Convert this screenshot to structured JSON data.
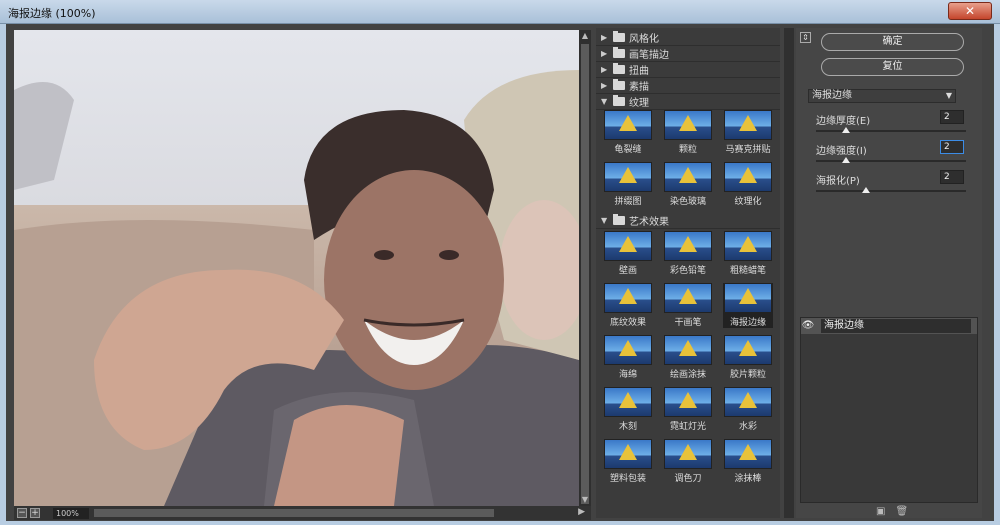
{
  "window": {
    "title": "海报边缘 (100%)",
    "close_label": "✕"
  },
  "preview": {
    "zoom": "100%",
    "zoom_out": "−",
    "zoom_in": "+"
  },
  "gallery": {
    "folders": [
      {
        "label": "风格化",
        "expanded": false
      },
      {
        "label": "画笔描边",
        "expanded": false
      },
      {
        "label": "扭曲",
        "expanded": false
      },
      {
        "label": "素描",
        "expanded": false
      },
      {
        "label": "纹理",
        "expanded": true
      },
      {
        "label": "艺术效果",
        "expanded": true
      }
    ],
    "texture_filters": [
      "龟裂缝",
      "颗粒",
      "马赛克拼贴",
      "拼缀图",
      "染色玻璃",
      "纹理化"
    ],
    "artistic_filters": [
      "壁画",
      "彩色铅笔",
      "粗糙蜡笔",
      "底纹效果",
      "干画笔",
      "海报边缘",
      "海绵",
      "绘画涂抹",
      "胶片颗粒",
      "木刻",
      "霓虹灯光",
      "水彩",
      "塑料包装",
      "调色刀",
      "涂抹棒"
    ],
    "selected_filter": "海报边缘"
  },
  "panel": {
    "ok_label": "确定",
    "reset_label": "复位",
    "filter_select": "海报边缘",
    "params": [
      {
        "label": "边缘厚度(E)",
        "value": "2",
        "fraction": 0.2
      },
      {
        "label": "边缘强度(I)",
        "value": "2",
        "fraction": 0.2,
        "active": true
      },
      {
        "label": "海报化(P)",
        "value": "2",
        "fraction": 0.33
      }
    ],
    "layer_name": "海报边缘"
  },
  "colors": {
    "accent_border": "#3c8ce6"
  }
}
